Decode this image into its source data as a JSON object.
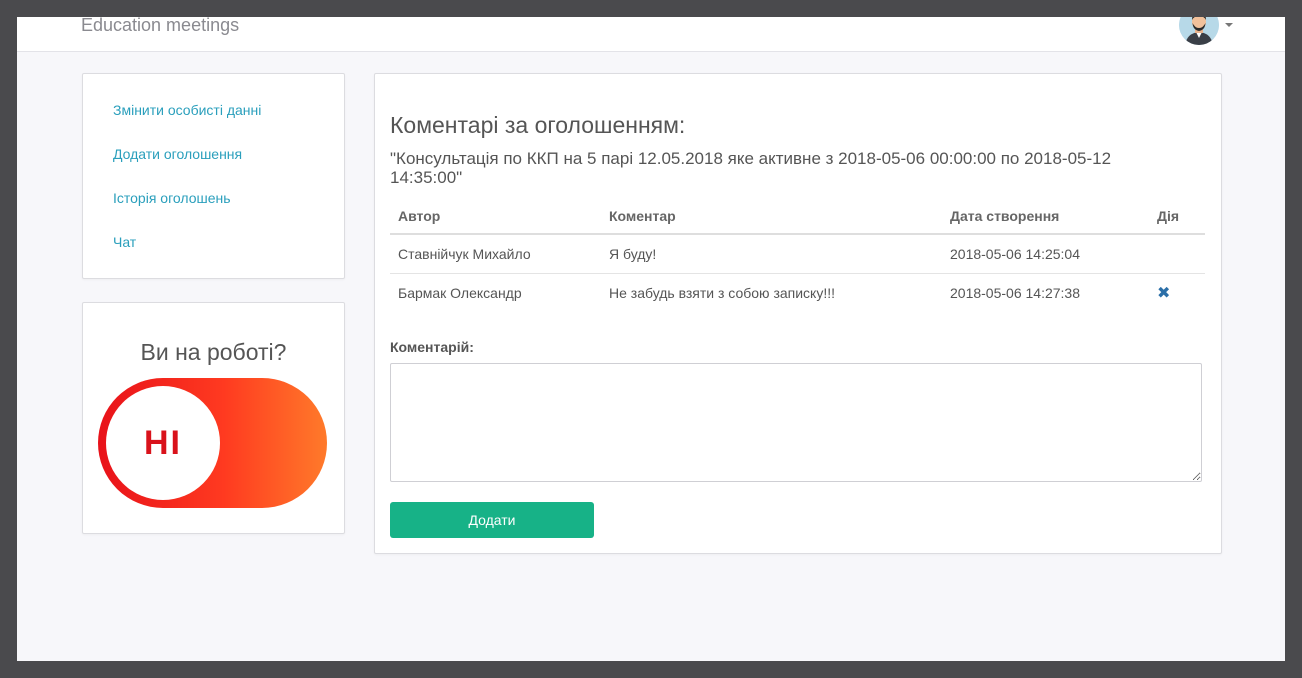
{
  "navbar": {
    "brand": "Education meetings",
    "avatar_icon": "user-avatar-icon",
    "menu_caret_icon": "chevron-down-icon"
  },
  "side_menu": {
    "items": [
      {
        "label": "Змінити особисті данні"
      },
      {
        "label": "Додати оголошення"
      },
      {
        "label": "Історія оголошень"
      },
      {
        "label": "Чат"
      }
    ]
  },
  "status": {
    "title": "Ви на роботі?",
    "toggle_label": "НІ",
    "toggle_on": false
  },
  "main": {
    "title": "Коментарі за оголошенням:",
    "subtitle": "\"Консультація по ККП на 5 парі 12.05.2018 яке активне з 2018-05-06 00:00:00 по 2018-05-12 14:35:00\"",
    "table": {
      "headers": [
        "Автор",
        "Коментар",
        "Дата створення",
        "Дія"
      ],
      "rows": [
        {
          "author": "Ставнійчук Михайло",
          "comment": "Я буду!",
          "date": "2018-05-06 14:25:04",
          "action": ""
        },
        {
          "author": "Бармак Олександр",
          "comment": "Не забудь взяти з собою записку!!!",
          "date": "2018-05-06 14:27:38",
          "action": "✖"
        }
      ]
    },
    "comment_label": "Коментарій:",
    "comment_value": "",
    "submit_label": "Додати"
  },
  "colors": {
    "link": "#2a9fbc",
    "button": "#17b287",
    "toggle_off": "#e8121a",
    "delete_icon": "#2b6fa8"
  }
}
